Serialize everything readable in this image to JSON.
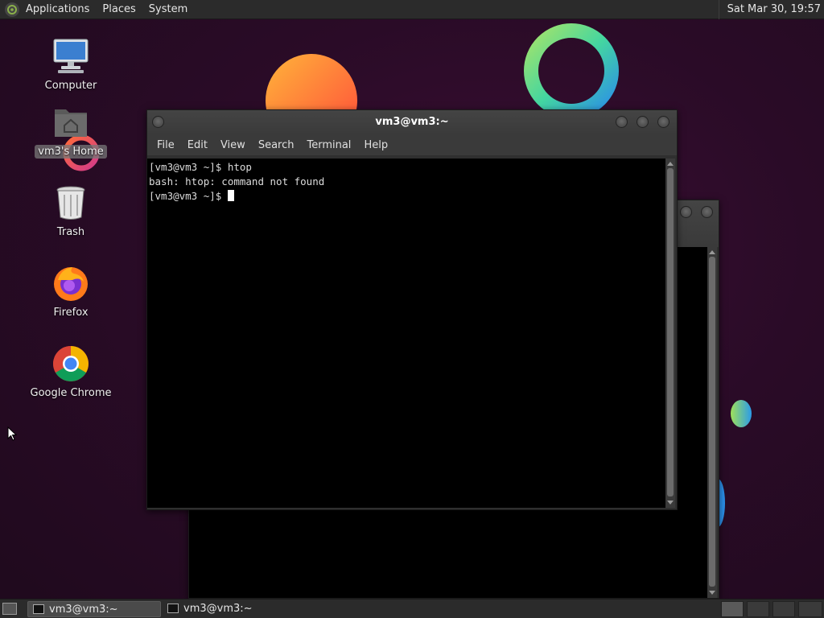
{
  "top_panel": {
    "menus": [
      "Applications",
      "Places",
      "System"
    ],
    "clock": "Sat Mar 30, 19:57"
  },
  "desktop_icons": [
    {
      "label": "Computer",
      "icon": "computer-icon"
    },
    {
      "label": "vm3's Home",
      "icon": "home-folder-icon"
    },
    {
      "label": "Trash",
      "icon": "trash-icon"
    },
    {
      "label": "Firefox",
      "icon": "firefox-icon"
    },
    {
      "label": "Google Chrome",
      "icon": "chrome-icon"
    }
  ],
  "terminal": {
    "title": "vm3@vm3:~",
    "menus": [
      "File",
      "Edit",
      "View",
      "Search",
      "Terminal",
      "Help"
    ],
    "lines": [
      "[vm3@vm3 ~]$ htop",
      "bash: htop: command not found",
      "[vm3@vm3 ~]$ "
    ]
  },
  "taskbar": {
    "tasks": [
      "vm3@vm3:~",
      "vm3@vm3:~"
    ]
  },
  "colors": {
    "panel": "#2b2b2b",
    "desktop": "#2a0b27",
    "terminal_bg": "#000000"
  }
}
